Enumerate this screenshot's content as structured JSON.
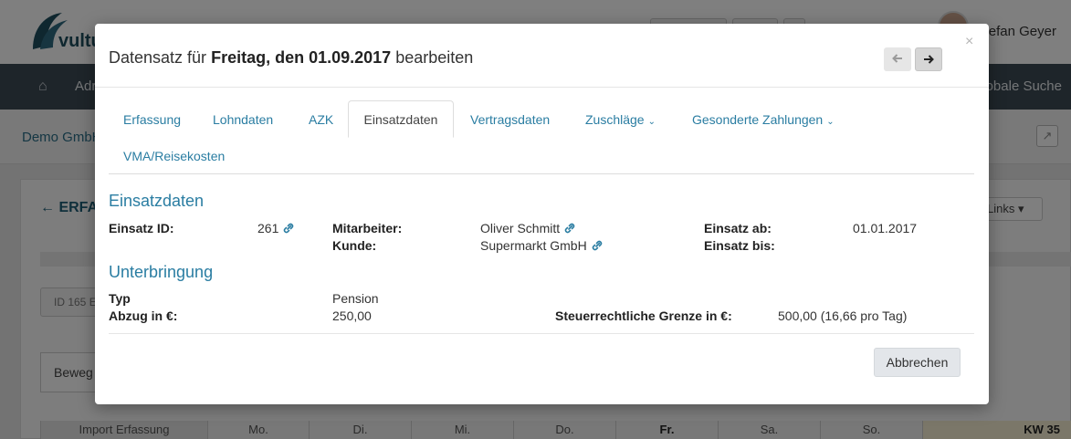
{
  "background": {
    "logo_text": "vultu",
    "user_name": "efan Geyer",
    "nav_item": "Adr",
    "nav_search": "obale Suche",
    "company": "Demo GmbH",
    "section_title": "ERFA",
    "links_button": "Links",
    "id_badge": "ID 165 E",
    "bewegung_tab": "Beweg",
    "import_label": "Import Erfassung",
    "weekdays": [
      "Mo.",
      "Di.",
      "Mi.",
      "Do.",
      "Fr.",
      "Sa.",
      "So."
    ],
    "week_label": "KW 35"
  },
  "modal": {
    "title_prefix": "Datensatz für",
    "title_bold": "Freitag, den 01.09.2017",
    "title_suffix": "bearbeiten",
    "prev_icon": "arrow-left-icon",
    "next_icon": "arrow-right-icon",
    "close_label": "×",
    "tabs": {
      "erfassung": "Erfassung",
      "lohndaten": "Lohndaten",
      "azk": "AZK",
      "einsatzdaten": "Einsatzdaten",
      "vertragsdaten": "Vertragsdaten",
      "zuschlaege": "Zuschläge",
      "gesonderte": "Gesonderte Zahlungen",
      "vma": "VMA/Reisekosten"
    },
    "active_tab": "Einsatzdaten",
    "einsatzdaten": {
      "heading": "Einsatzdaten",
      "einsatz_id_label": "Einsatz ID:",
      "einsatz_id_value": "261",
      "mitarbeiter_label": "Mitarbeiter:",
      "mitarbeiter_value": "Oliver Schmitt",
      "kunde_label": "Kunde:",
      "kunde_value": "Supermarkt GmbH",
      "einsatz_ab_label": "Einsatz ab:",
      "einsatz_ab_value": "01.01.2017",
      "einsatz_bis_label": "Einsatz bis:",
      "einsatz_bis_value": ""
    },
    "unterbringung": {
      "heading": "Unterbringung",
      "typ_label": "Typ",
      "typ_value": "Pension",
      "abzug_label": "Abzug in €:",
      "abzug_value": "250,00",
      "grenze_label": "Steuerrechtliche Grenze in €:",
      "grenze_value": "500,00 (16,66 pro Tag)"
    },
    "cancel_label": "Abbrechen"
  },
  "colors": {
    "accent": "#2a7da2",
    "navbar": "#3d4a55",
    "overlay": "rgba(0,0,0,0.5)"
  }
}
